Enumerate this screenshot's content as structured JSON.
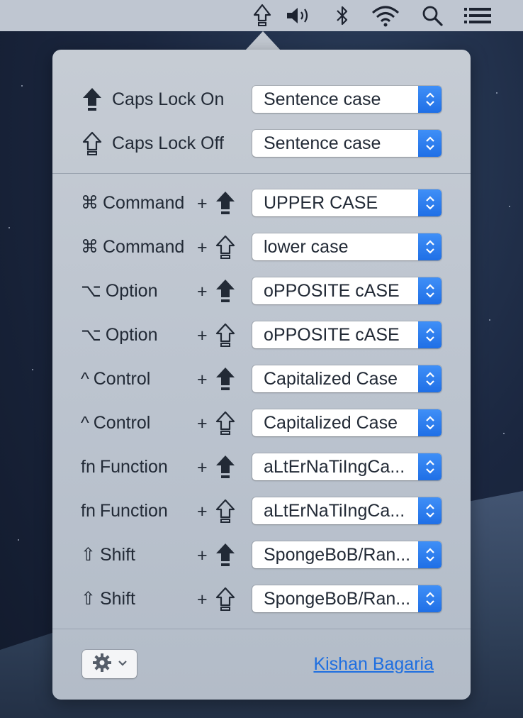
{
  "menubar": {
    "icons": [
      "shift-outline-icon",
      "volume-icon",
      "bluetooth-icon",
      "wifi-icon",
      "search-icon",
      "control-strip-list-icon"
    ]
  },
  "popover": {
    "caps_on": {
      "label": "Caps Lock On",
      "value": "Sentence case"
    },
    "caps_off": {
      "label": "Caps Lock Off",
      "value": "Sentence case"
    },
    "rows": [
      {
        "glyph": "⌘",
        "modifier": "Command",
        "plus": "+",
        "arrow": "filled",
        "value": "UPPER CASE"
      },
      {
        "glyph": "⌘",
        "modifier": "Command",
        "plus": "+",
        "arrow": "outline",
        "value": "lower case"
      },
      {
        "glyph": "⌥",
        "modifier": "Option",
        "plus": "+",
        "arrow": "filled",
        "value": "oPPOSITE cASE"
      },
      {
        "glyph": "⌥",
        "modifier": "Option",
        "plus": "+",
        "arrow": "outline",
        "value": "oPPOSITE cASE"
      },
      {
        "glyph": "^",
        "modifier": "Control",
        "plus": "+",
        "arrow": "filled",
        "value": "Capitalized Case"
      },
      {
        "glyph": "^",
        "modifier": "Control",
        "plus": "+",
        "arrow": "outline",
        "value": "Capitalized Case"
      },
      {
        "glyph": "fn",
        "modifier": "Function",
        "plus": "+",
        "arrow": "filled",
        "value": "aLtErNaTiIngCa..."
      },
      {
        "glyph": "fn",
        "modifier": "Function",
        "plus": "+",
        "arrow": "outline",
        "value": "aLtErNaTiIngCa..."
      },
      {
        "glyph": "⇧",
        "modifier": "Shift",
        "plus": "+",
        "arrow": "filled",
        "value": "SpongeBoB/Ran..."
      },
      {
        "glyph": "⇧",
        "modifier": "Shift",
        "plus": "+",
        "arrow": "outline",
        "value": "SpongeBoB/Ran..."
      }
    ],
    "footer": {
      "settings_icon": "gear-icon",
      "dropdown_icon": "chevron-down-icon",
      "author_link": "Kishan Bagaria"
    }
  },
  "colors": {
    "accent": "#1f6fe6",
    "link": "#1f6fe0",
    "text": "#222a36",
    "panel": "#bcc4cf"
  }
}
